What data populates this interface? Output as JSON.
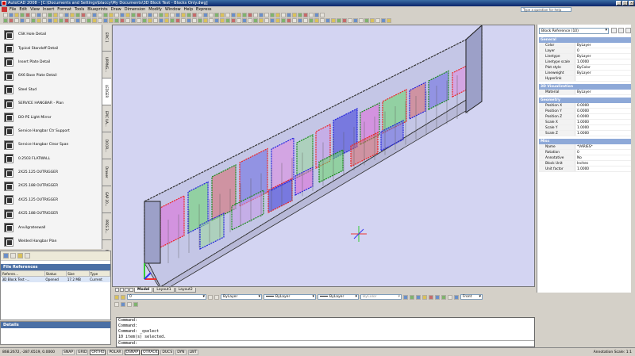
{
  "window": {
    "title": "AutoCAD 2008 - [C:\\Documents and Settings\\blaccy\\My Documents\\3D Block Test - Blocks Only.dwg]",
    "minimize": "_",
    "maximize": "□",
    "close": "×"
  },
  "menu": {
    "items": [
      "File",
      "Edit",
      "View",
      "Insert",
      "Format",
      "Tools",
      "Blueprints",
      "Draw",
      "Dimension",
      "Modify",
      "Window",
      "Help",
      "Express"
    ],
    "search_placeholder": "Type a question for help"
  },
  "palette": {
    "items": [
      {
        "label": "CSK Hole Detail"
      },
      {
        "label": "Typical Standoff Detail"
      },
      {
        "label": "Insert Plate Detail"
      },
      {
        "label": "6X6 Base Plate Detail"
      },
      {
        "label": "Steel Stud"
      },
      {
        "label": "SERVICE HANGBAR - Plan"
      },
      {
        "label": "DO-PE Light Mirror"
      },
      {
        "label": "Service Hangbar Ctr Support"
      },
      {
        "label": "Service Hangbar Clear Span"
      },
      {
        "label": "0.2503 FLATWALL"
      },
      {
        "label": "2X25.125 OUTRIGGER"
      },
      {
        "label": "2X25.188 OUTRIGGER"
      },
      {
        "label": "4X25.125 OUTRIGGER"
      },
      {
        "label": "4X25.188 OUTRIGGER"
      },
      {
        "label": "Anvilgrateswall"
      },
      {
        "label": "Welded Hangbar Plan"
      }
    ],
    "tabs": [
      "EPIC 1",
      "UPPING...",
      "LEDGER",
      "EPIC UA...",
      "DOOR...",
      "Drawer",
      "GAP 20...",
      "PPES 3...",
      "Misc",
      "PENI 30..."
    ]
  },
  "xref": {
    "title": "File References",
    "columns": [
      "Referen...",
      "Status",
      "Size",
      "Type"
    ],
    "rows": [
      {
        "name": "3D Block Test -...",
        "status": "Opened",
        "size": "17.2 MB",
        "type": "Current"
      }
    ],
    "details_title": "Details"
  },
  "layout_tabs": [
    "Model",
    "Layout1",
    "Layout2"
  ],
  "properties_toolbar": {
    "layer_value": "0",
    "color_value": "ByLayer",
    "linetype_value": "ByLayer",
    "lineweight_value": "ByLayer",
    "plotstyle_value": "ByColor",
    "view_value": "Front"
  },
  "command": {
    "lines": [
      "Command:",
      "Command:",
      "Command: _qselect",
      "10 item(s) selected.",
      "Command:"
    ],
    "prompt": "Command:"
  },
  "properties": {
    "selection": "Block Reference (10)",
    "sections": [
      {
        "title": "General",
        "rows": [
          {
            "k": "Color",
            "v": "ByLayer"
          },
          {
            "k": "Layer",
            "v": "0"
          },
          {
            "k": "Linetype",
            "v": "ByLayer"
          },
          {
            "k": "Linetype scale",
            "v": "1.0000"
          },
          {
            "k": "Plot style",
            "v": "ByColor"
          },
          {
            "k": "Lineweight",
            "v": "ByLayer"
          },
          {
            "k": "Hyperlink",
            "v": ""
          }
        ]
      },
      {
        "title": "3D Visualization",
        "rows": [
          {
            "k": "Material",
            "v": "ByLayer"
          }
        ]
      },
      {
        "title": "Geometry",
        "rows": [
          {
            "k": "Position X",
            "v": "0.0000"
          },
          {
            "k": "Position Y",
            "v": "0.0000"
          },
          {
            "k": "Position Z",
            "v": "0.0000"
          },
          {
            "k": "Scale X",
            "v": "1.0000"
          },
          {
            "k": "Scale Y",
            "v": "1.0000"
          },
          {
            "k": "Scale Z",
            "v": "1.0000"
          }
        ]
      },
      {
        "title": "Misc",
        "rows": [
          {
            "k": "Name",
            "v": "*VARIES*"
          },
          {
            "k": "Rotation",
            "v": "0"
          },
          {
            "k": "Annotative",
            "v": "No"
          },
          {
            "k": "Block Unit",
            "v": "Inches"
          },
          {
            "k": "Unit factor",
            "v": "1.0000"
          }
        ]
      }
    ]
  },
  "statusbar": {
    "coords": "868.2672, -287.6519, 0.0000",
    "toggles": [
      {
        "label": "SNAP",
        "on": false
      },
      {
        "label": "GRID",
        "on": false
      },
      {
        "label": "ORTHO",
        "on": true
      },
      {
        "label": "POLAR",
        "on": false
      },
      {
        "label": "OSNAP",
        "on": true
      },
      {
        "label": "OTRACK",
        "on": true
      },
      {
        "label": "DUCS",
        "on": false
      },
      {
        "label": "DYN",
        "on": false
      },
      {
        "label": "LWT",
        "on": false
      }
    ],
    "annotation_scale": "Annotation Scale: 1:1"
  },
  "colors": {
    "canvas_bg": "#d3d4f2",
    "title_blue": "#0a246a",
    "section_head": "#8ea9d8"
  }
}
